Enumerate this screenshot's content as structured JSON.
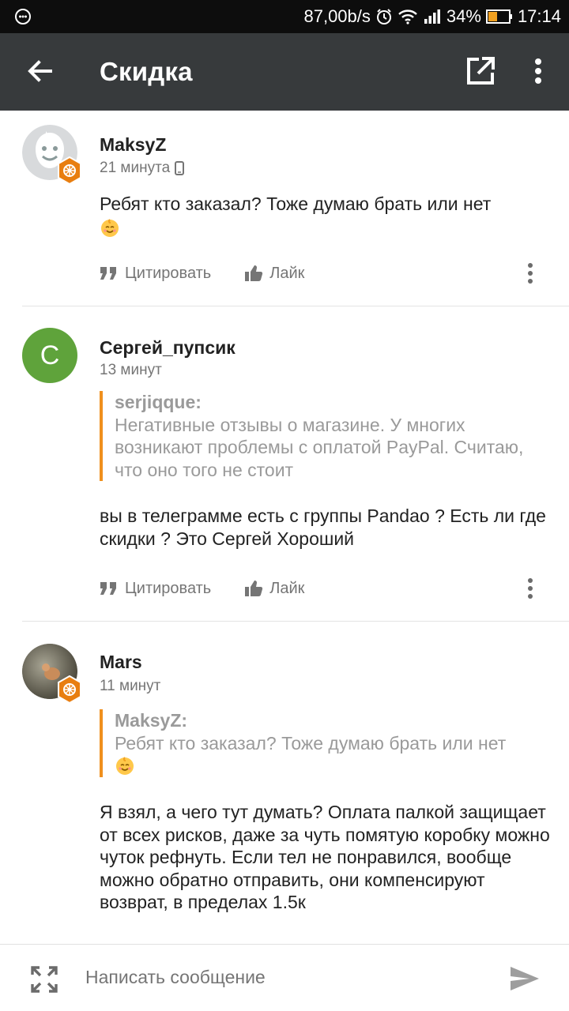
{
  "status_bar": {
    "speed": "87,00b/s",
    "battery_percent": "34%",
    "time": "17:14"
  },
  "app_bar": {
    "title": "Скидка"
  },
  "comments": [
    {
      "author": "MaksyZ",
      "time": "21 минута",
      "text": "Ребят кто заказал? Тоже думаю брать или нет",
      "has_emoji": true,
      "quote_label": "Цитировать",
      "like_label": "Лайк"
    },
    {
      "author": "Сергей_пупсик",
      "avatar_letter": "С",
      "time": "13 минут",
      "quote": {
        "author": "serjiqque:",
        "text": "Негативные отзывы о магазине. У многих возникают проблемы с оплатой PayPal. Считаю, что оно того не стоит"
      },
      "text": "вы в телеграмме есть с группы Pandao ? Есть ли где скидки ? Это Сергей Хороший",
      "quote_label": "Цитировать",
      "like_label": "Лайк"
    },
    {
      "author": "Mars",
      "time": "11 минут",
      "quote": {
        "author": "MaksyZ:",
        "text": "Ребят кто заказал? Тоже думаю брать или нет"
      },
      "text": "Я взял, а чего тут думать? Оплата палкой защищает от всех рисков, даже за чуть помятую коробку можно чуток рефнуть. Если тел не понравился, вообще можно обратно отправить, они компенсируют возврат, в пределах 1.5к"
    }
  ],
  "composer": {
    "placeholder": "Написать сообщение"
  },
  "colors": {
    "app_bar": "#373a3c",
    "quote_accent": "#f0901e",
    "avatar_green": "#5fa33b",
    "badge_orange": "#e87e10"
  },
  "icons": [
    "back-arrow-icon",
    "open-external-icon",
    "more-vert-icon",
    "quote-icon",
    "thumb-up-icon",
    "expand-icon",
    "send-icon",
    "phone-icon",
    "smile-emoji-icon"
  ]
}
